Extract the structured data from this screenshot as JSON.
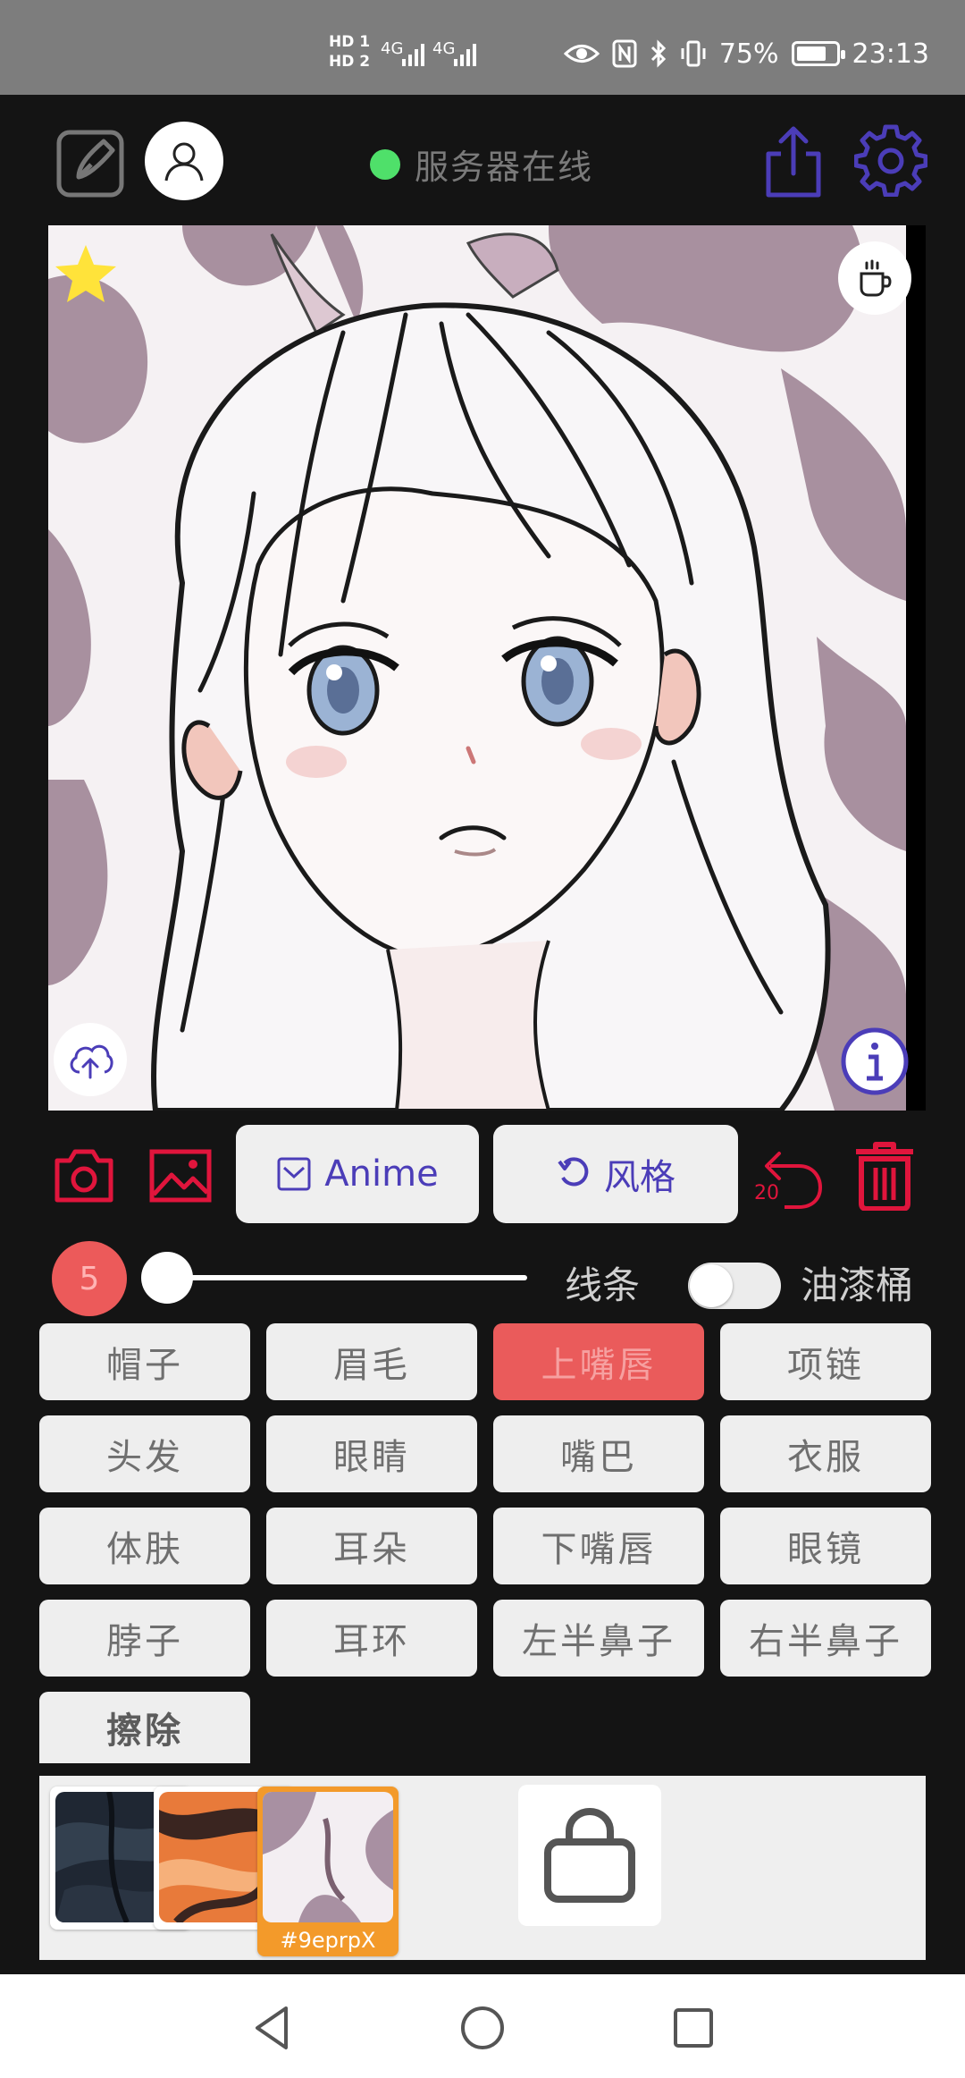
{
  "status_bar": {
    "sim1": "HD 1",
    "sim2": "HD 2",
    "net1": "4G",
    "net2": "4G",
    "battery": "75%",
    "battery_level": 0.75,
    "time": "23:13"
  },
  "toolbar": {
    "server_status": "服务器在线",
    "status_color": "#4fe06a"
  },
  "canvas": {
    "icons": [
      "star-icon",
      "coffee-cup-icon",
      "cloud-upload-icon",
      "info-icon"
    ]
  },
  "actions": {
    "model_button": "Anime",
    "style_button": "风格",
    "undo_count": "20"
  },
  "brush": {
    "size": "5",
    "size_level": 0.0,
    "line_label": "线条",
    "bucket_label": "油漆桶",
    "bucket_on": false
  },
  "labels": [
    "帽子",
    "眉毛",
    "上嘴唇",
    "项链",
    "头发",
    "眼睛",
    "嘴巴",
    "衣服",
    "体肤",
    "耳朵",
    "下嘴唇",
    "眼镜",
    "脖子",
    "耳环",
    "左半鼻子",
    "右半鼻子"
  ],
  "active_label": "上嘴唇",
  "erase_label": "擦除",
  "palette": {
    "selected_code": "#9eprpX",
    "accent": "#f39a2a"
  },
  "colors": {
    "accent_red": "#e0153c",
    "accent_purple": "#4b3db8"
  }
}
